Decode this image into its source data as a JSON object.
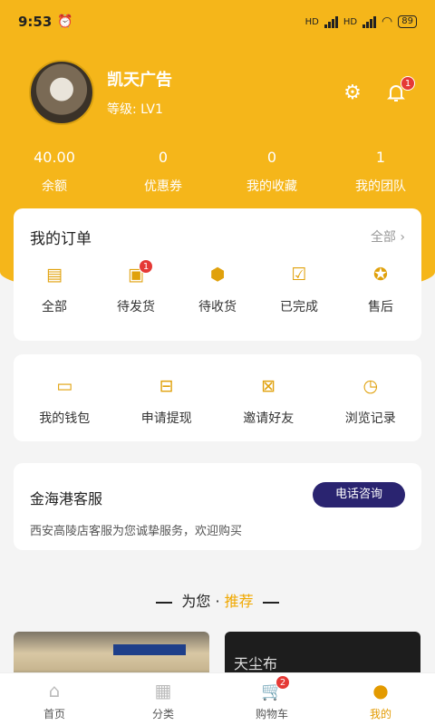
{
  "status": {
    "time": "9:53",
    "battery": "89",
    "hd1": "HD",
    "hd2": "HD"
  },
  "profile": {
    "name": "凯天广告",
    "level": "等级: LV1",
    "notif_badge": "1"
  },
  "stats": [
    {
      "value": "40.00",
      "label": "余额"
    },
    {
      "value": "0",
      "label": "优惠券"
    },
    {
      "value": "0",
      "label": "我的收藏"
    },
    {
      "value": "1",
      "label": "我的团队"
    }
  ],
  "orders": {
    "title": "我的订单",
    "all": "全部 ›",
    "items": [
      {
        "label": "全部",
        "icon": "clipboard-icon"
      },
      {
        "label": "待发货",
        "icon": "package-icon",
        "badge": "1"
      },
      {
        "label": "待收货",
        "icon": "box-icon"
      },
      {
        "label": "已完成",
        "icon": "check-icon"
      },
      {
        "label": "售后",
        "icon": "wrench-icon"
      }
    ]
  },
  "wallet": [
    {
      "label": "我的钱包",
      "icon": "wallet-icon"
    },
    {
      "label": "申请提现",
      "icon": "withdraw-icon"
    },
    {
      "label": "邀请好友",
      "icon": "invite-icon"
    },
    {
      "label": "浏览记录",
      "icon": "clock-icon"
    }
  ],
  "service": {
    "title": "金海港客服",
    "button": "电话咨询",
    "desc": "西安高陵店客服为您诚挚服务，欢迎购买"
  },
  "recommend": {
    "prefix": "为您 · ",
    "highlight": "推荐"
  },
  "product2_text": "天尘布",
  "tabs": [
    {
      "label": "首页",
      "icon": "home-icon"
    },
    {
      "label": "分类",
      "icon": "category-icon"
    },
    {
      "label": "购物车",
      "icon": "cart-icon",
      "badge": "2"
    },
    {
      "label": "我的",
      "icon": "profile-icon"
    }
  ],
  "colors": {
    "accent": "#f5b61a",
    "button": "#2a2470",
    "active_tab": "#e39a00"
  }
}
